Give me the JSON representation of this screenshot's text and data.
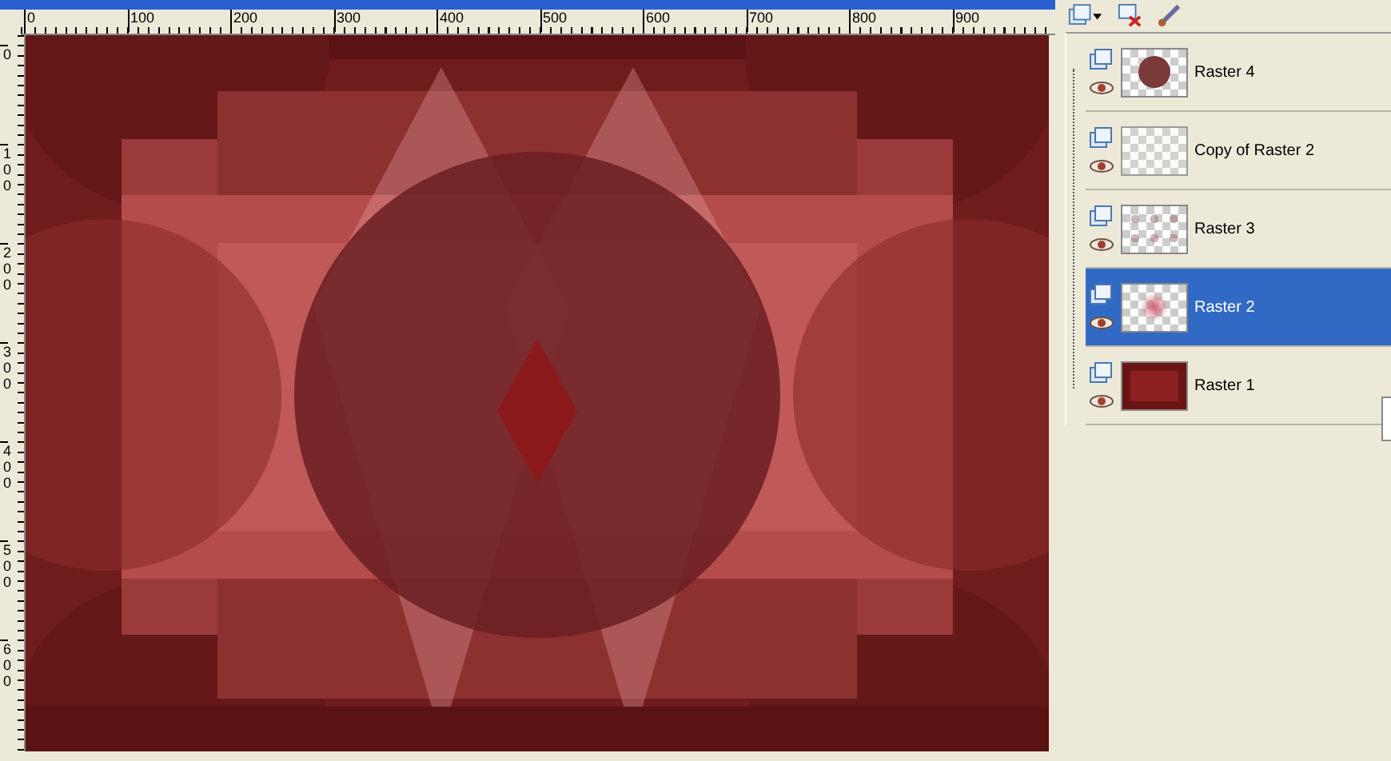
{
  "ruler_horizontal": [
    "0",
    "100",
    "200",
    "300",
    "400",
    "500",
    "600",
    "700",
    "800",
    "900"
  ],
  "ruler_vertical": [
    "0",
    "100",
    "200",
    "300",
    "400",
    "500",
    "600"
  ],
  "layers": [
    {
      "name": "Raster 4",
      "selected": false,
      "kind": "circle"
    },
    {
      "name": "Copy of Raster 2",
      "selected": false,
      "kind": "faint"
    },
    {
      "name": "Raster 3",
      "selected": false,
      "kind": "dots"
    },
    {
      "name": "Raster 2",
      "selected": true,
      "kind": "glow"
    },
    {
      "name": "Raster 1",
      "selected": false,
      "kind": "frame"
    }
  ]
}
